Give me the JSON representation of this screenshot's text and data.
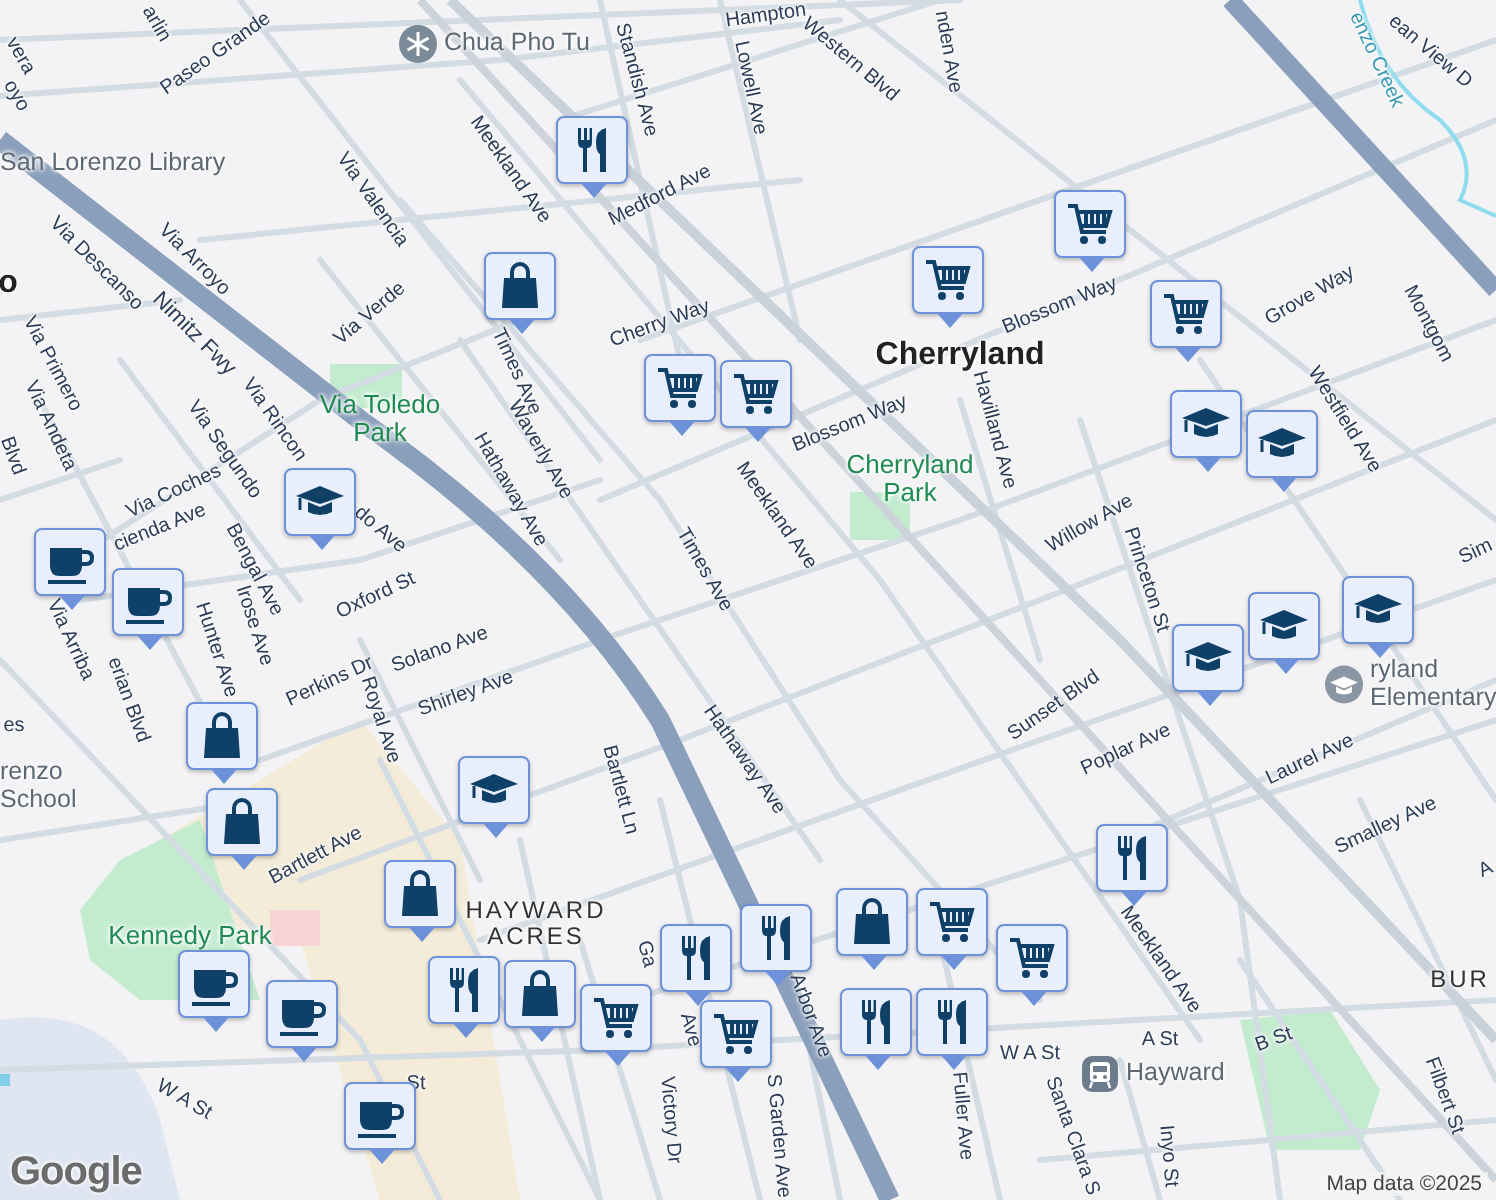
{
  "map": {
    "labels": [
      {
        "text": "arlin",
        "kind": "street"
      },
      {
        "text": "vera",
        "kind": "street"
      },
      {
        "text": "oyo",
        "kind": "street"
      },
      {
        "text": "Paseo Grande",
        "kind": "street"
      },
      {
        "text": "Chua Pho Tu",
        "kind": "temple"
      },
      {
        "text": "Hampton",
        "kind": "street"
      },
      {
        "text": "Standish Ave",
        "kind": "street"
      },
      {
        "text": "Lowell Ave",
        "kind": "street"
      },
      {
        "text": "Western Blvd",
        "kind": "street"
      },
      {
        "text": "nden Ave",
        "kind": "street"
      },
      {
        "text": "San Lorenzo Library",
        "kind": "poi"
      },
      {
        "text": "o",
        "kind": "place"
      },
      {
        "text": "Meekland Ave",
        "kind": "street"
      },
      {
        "text": "Medford Ave",
        "kind": "street"
      },
      {
        "text": "Via Valencia",
        "kind": "street"
      },
      {
        "text": "Via Descanso",
        "kind": "street"
      },
      {
        "text": "Via Arroyo",
        "kind": "street"
      },
      {
        "text": "Nimitz Fwy",
        "kind": "highway"
      },
      {
        "text": "Via Verde",
        "kind": "street"
      },
      {
        "text": "Times Ave",
        "kind": "street"
      },
      {
        "text": "Cherry Way",
        "kind": "street"
      },
      {
        "text": "Cherryland",
        "kind": "place"
      },
      {
        "text": "Blossom Way",
        "kind": "street"
      },
      {
        "text": "Blossom Way",
        "kind": "street"
      },
      {
        "text": "Grove Way",
        "kind": "street"
      },
      {
        "text": "Montgom",
        "kind": "street"
      },
      {
        "text": "ean View D",
        "kind": "street"
      },
      {
        "text": "enzo Creek",
        "kind": "water"
      },
      {
        "text": "Via Primero",
        "kind": "street"
      },
      {
        "text": "Via Andeta",
        "kind": "street"
      },
      {
        "text": "Blvd",
        "kind": "street"
      },
      {
        "text": "Via Rincon",
        "kind": "street"
      },
      {
        "text": "Via Segundo",
        "kind": "street"
      },
      {
        "text": "Via Toledo Park",
        "kind": "park"
      },
      {
        "text": "Waverly Ave",
        "kind": "street"
      },
      {
        "text": "Hathaway Ave",
        "kind": "street"
      },
      {
        "text": "Cherryland Park",
        "kind": "park"
      },
      {
        "text": "Havilland Ave",
        "kind": "street"
      },
      {
        "text": "Westfield Ave",
        "kind": "street"
      },
      {
        "text": "Meekland Ave",
        "kind": "street"
      },
      {
        "text": "Via Coches",
        "kind": "street"
      },
      {
        "text": "cienda Ave",
        "kind": "street"
      },
      {
        "text": "do Ave",
        "kind": "street"
      },
      {
        "text": "Bengal Ave",
        "kind": "street"
      },
      {
        "text": "Times Ave",
        "kind": "street"
      },
      {
        "text": "Willow Ave",
        "kind": "street"
      },
      {
        "text": "Princeton St",
        "kind": "street"
      },
      {
        "text": "Sim",
        "kind": "street"
      },
      {
        "text": "ryland Elementary",
        "kind": "school"
      },
      {
        "text": "Oxford St",
        "kind": "street"
      },
      {
        "text": "Via Arriba",
        "kind": "street"
      },
      {
        "text": "erian Blvd",
        "kind": "street"
      },
      {
        "text": "Hunter Ave",
        "kind": "street"
      },
      {
        "text": "lrose Ave",
        "kind": "street"
      },
      {
        "text": "Perkins Dr",
        "kind": "street"
      },
      {
        "text": "Solano Ave",
        "kind": "street"
      },
      {
        "text": "Royal Ave",
        "kind": "street"
      },
      {
        "text": "Shirley Ave",
        "kind": "street"
      },
      {
        "text": "es",
        "kind": "street"
      },
      {
        "text": "renzo School",
        "kind": "poi"
      },
      {
        "text": "Sunset Blvd",
        "kind": "street"
      },
      {
        "text": "Hathaway Ave",
        "kind": "street"
      },
      {
        "text": "Poplar Ave",
        "kind": "street"
      },
      {
        "text": "Laurel Ave",
        "kind": "street"
      },
      {
        "text": "Bartlett Ln",
        "kind": "street"
      },
      {
        "text": "Smalley Ave",
        "kind": "street"
      },
      {
        "text": "Bartlett Ave",
        "kind": "street"
      },
      {
        "text": "A",
        "kind": "street"
      },
      {
        "text": "Kennedy Park",
        "kind": "park"
      },
      {
        "text": "HAYWARD ACRES",
        "kind": "area"
      },
      {
        "text": "Meekland Ave",
        "kind": "street"
      },
      {
        "text": "BUR",
        "kind": "area"
      },
      {
        "text": "Arbor Ave",
        "kind": "street"
      },
      {
        "text": "Ga",
        "kind": "street"
      },
      {
        "text": "Ave",
        "kind": "street"
      },
      {
        "text": "W A St",
        "kind": "street"
      },
      {
        "text": "A St",
        "kind": "street"
      },
      {
        "text": "B St",
        "kind": "street"
      },
      {
        "text": "Hayward",
        "kind": "station"
      },
      {
        "text": "W A St",
        "kind": "street"
      },
      {
        "text": "St",
        "kind": "street"
      },
      {
        "text": "Fuller Ave",
        "kind": "street"
      },
      {
        "text": "Filbert St",
        "kind": "street"
      },
      {
        "text": "Victory Dr",
        "kind": "street"
      },
      {
        "text": "S Garden Ave",
        "kind": "street"
      },
      {
        "text": "Santa Clara S",
        "kind": "street"
      },
      {
        "text": "Inyo St",
        "kind": "street"
      }
    ],
    "pins": [
      {
        "kind": "food"
      },
      {
        "kind": "shop"
      },
      {
        "kind": "cart"
      },
      {
        "kind": "cart"
      },
      {
        "kind": "cart"
      },
      {
        "kind": "cart"
      },
      {
        "kind": "cart"
      },
      {
        "kind": "school"
      },
      {
        "kind": "school"
      },
      {
        "kind": "school"
      },
      {
        "kind": "cafe"
      },
      {
        "kind": "cafe"
      },
      {
        "kind": "school"
      },
      {
        "kind": "school"
      },
      {
        "kind": "school"
      },
      {
        "kind": "shop"
      },
      {
        "kind": "shop"
      },
      {
        "kind": "school"
      },
      {
        "kind": "food"
      },
      {
        "kind": "shop"
      },
      {
        "kind": "food"
      },
      {
        "kind": "shop"
      },
      {
        "kind": "cart"
      },
      {
        "kind": "cafe"
      },
      {
        "kind": "cafe"
      },
      {
        "kind": "food"
      },
      {
        "kind": "food"
      },
      {
        "kind": "cart"
      },
      {
        "kind": "shop"
      },
      {
        "kind": "cart"
      },
      {
        "kind": "food"
      },
      {
        "kind": "cart"
      },
      {
        "kind": "food"
      },
      {
        "kind": "cafe"
      }
    ],
    "logo": "Google",
    "attribution": "Map data ©2025"
  }
}
